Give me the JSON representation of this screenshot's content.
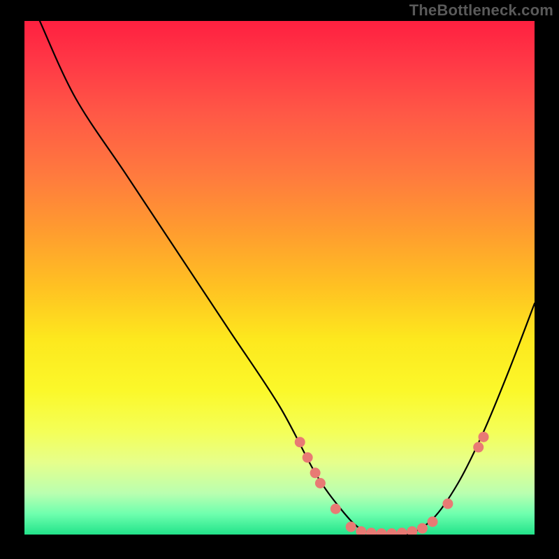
{
  "watermark": "TheBottleneck.com",
  "colors": {
    "background": "#000000",
    "curve": "#000000",
    "markers": "#e87a74"
  },
  "chart_data": {
    "type": "line",
    "title": "",
    "xlabel": "",
    "ylabel": "",
    "xlim": [
      0,
      100
    ],
    "ylim": [
      0,
      100
    ],
    "description": "Bottleneck severity curve over a red-to-green vertical gradient. Lower y (bottom / green) indicates least bottleneck.",
    "series": [
      {
        "name": "bottleneck-curve",
        "x": [
          3,
          10,
          20,
          30,
          40,
          50,
          57,
          62,
          66,
          70,
          75,
          80,
          85,
          90,
          95,
          100
        ],
        "y": [
          100,
          85,
          70,
          55,
          40,
          25,
          12,
          5,
          1,
          0,
          0,
          3,
          10,
          20,
          32,
          45
        ]
      }
    ],
    "markers": {
      "name": "highlighted-points",
      "points": [
        {
          "x": 54,
          "y": 18
        },
        {
          "x": 55.5,
          "y": 15
        },
        {
          "x": 57,
          "y": 12
        },
        {
          "x": 58,
          "y": 10
        },
        {
          "x": 61,
          "y": 5
        },
        {
          "x": 64,
          "y": 1.5
        },
        {
          "x": 66,
          "y": 0.6
        },
        {
          "x": 68,
          "y": 0.3
        },
        {
          "x": 70,
          "y": 0.2
        },
        {
          "x": 72,
          "y": 0.2
        },
        {
          "x": 74,
          "y": 0.3
        },
        {
          "x": 76,
          "y": 0.6
        },
        {
          "x": 78,
          "y": 1.2
        },
        {
          "x": 80,
          "y": 2.5
        },
        {
          "x": 83,
          "y": 6
        },
        {
          "x": 89,
          "y": 17
        },
        {
          "x": 90,
          "y": 19
        }
      ]
    }
  }
}
